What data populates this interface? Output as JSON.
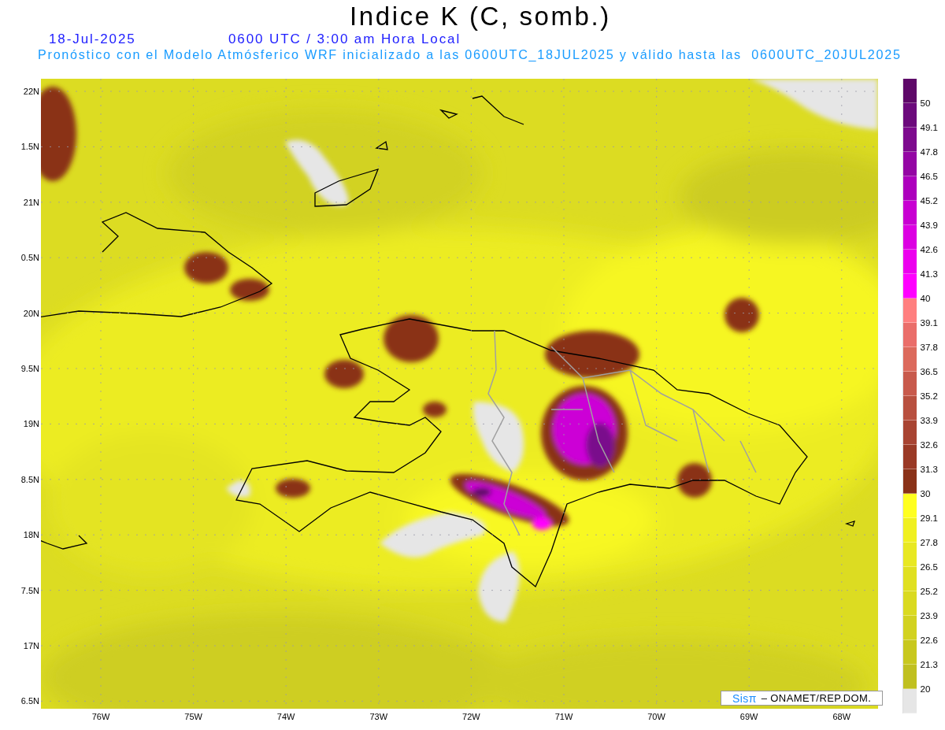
{
  "title": "Indice K (C, somb.)",
  "date": "18-Jul-2025",
  "time": "0600 UTC / 3:00 am Hora Local",
  "description": "Pronóstico con el Modelo Atmósferico WRF inicializado a las 0600UTC_18JUL2025 y válido hasta las  0600UTC_20JUL2025",
  "map": {
    "lat_labels": [
      "22N",
      "1.5N",
      "21N",
      "0.5N",
      "20N",
      "9.5N",
      "19N",
      "8.5N",
      "18N",
      "7.5N",
      "17N",
      "6.5N"
    ],
    "lon_labels": [
      "76W",
      "75W",
      "74W",
      "73W",
      "72W",
      "71W",
      "70W",
      "69W",
      "68W"
    ]
  },
  "colorbar": {
    "steps": [
      {
        "label": "50",
        "color": "#5e0868"
      },
      {
        "label": "49.1",
        "color": "#6c0a7c"
      },
      {
        "label": "47.8",
        "color": "#7d0a8e"
      },
      {
        "label": "46.5",
        "color": "#9406a4"
      },
      {
        "label": "45.2",
        "color": "#ad00bd"
      },
      {
        "label": "43.9",
        "color": "#c800d2"
      },
      {
        "label": "42.6",
        "color": "#dc00e2"
      },
      {
        "label": "41.3",
        "color": "#ec00ee"
      },
      {
        "label": "40",
        "color": "#ff00ff"
      },
      {
        "label": "39.1",
        "color": "#ff7f7f"
      },
      {
        "label": "37.8",
        "color": "#ea6e6a"
      },
      {
        "label": "36.5",
        "color": "#dc6a5c"
      },
      {
        "label": "35.2",
        "color": "#c85a4c"
      },
      {
        "label": "33.9",
        "color": "#b8503f"
      },
      {
        "label": "32.6",
        "color": "#a84432"
      },
      {
        "label": "31.3",
        "color": "#9a3a26"
      },
      {
        "label": "30",
        "color": "#8a3218"
      },
      {
        "label": "29.1",
        "color": "#ffff20"
      },
      {
        "label": "27.8",
        "color": "#f0f020"
      },
      {
        "label": "26.5",
        "color": "#e8e822"
      },
      {
        "label": "25.2",
        "color": "#e0e020"
      },
      {
        "label": "23.9",
        "color": "#dada20"
      },
      {
        "label": "22.6",
        "color": "#d2d220"
      },
      {
        "label": "21.3",
        "color": "#c8c81e"
      },
      {
        "label": "20",
        "color": "#c0c020"
      }
    ],
    "below_range": {
      "color": "#e6e6e6"
    }
  },
  "credit": {
    "brand": "Sisπ",
    "text": "– ONAMET/REP.DOM."
  }
}
